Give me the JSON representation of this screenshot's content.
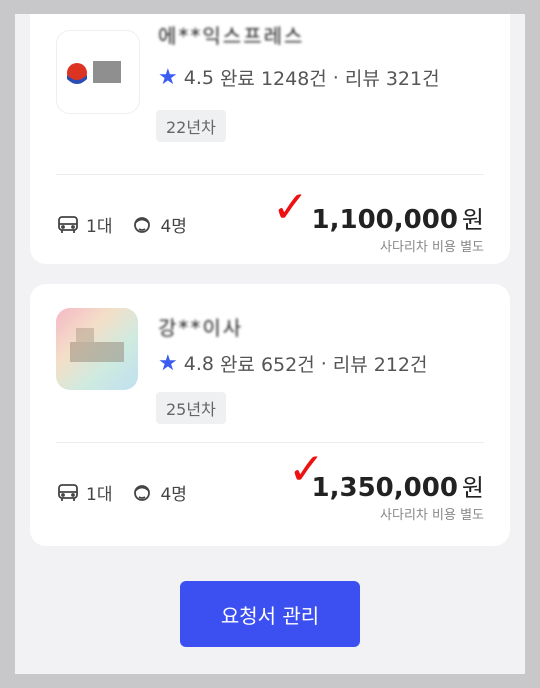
{
  "cards": [
    {
      "name": "에**익스프레스",
      "rating": "4.5",
      "completed": "완료 1248건",
      "reviews": "리뷰 321건",
      "years": "22년차",
      "trucks": "1대",
      "workers": "4명",
      "price": "1,100,000",
      "currency": "원",
      "note": "사다리차 비용 별도"
    },
    {
      "name": "강**이사",
      "rating": "4.8",
      "completed": "완료 652건",
      "reviews": "리뷰 212건",
      "years": "25년차",
      "trucks": "1대",
      "workers": "4명",
      "price": "1,350,000",
      "currency": "원",
      "note": "사다리차 비용 별도"
    }
  ],
  "button": {
    "label": "요청서 관리"
  },
  "colors": {
    "accent": "#3c50f2",
    "check": "#e11111"
  }
}
